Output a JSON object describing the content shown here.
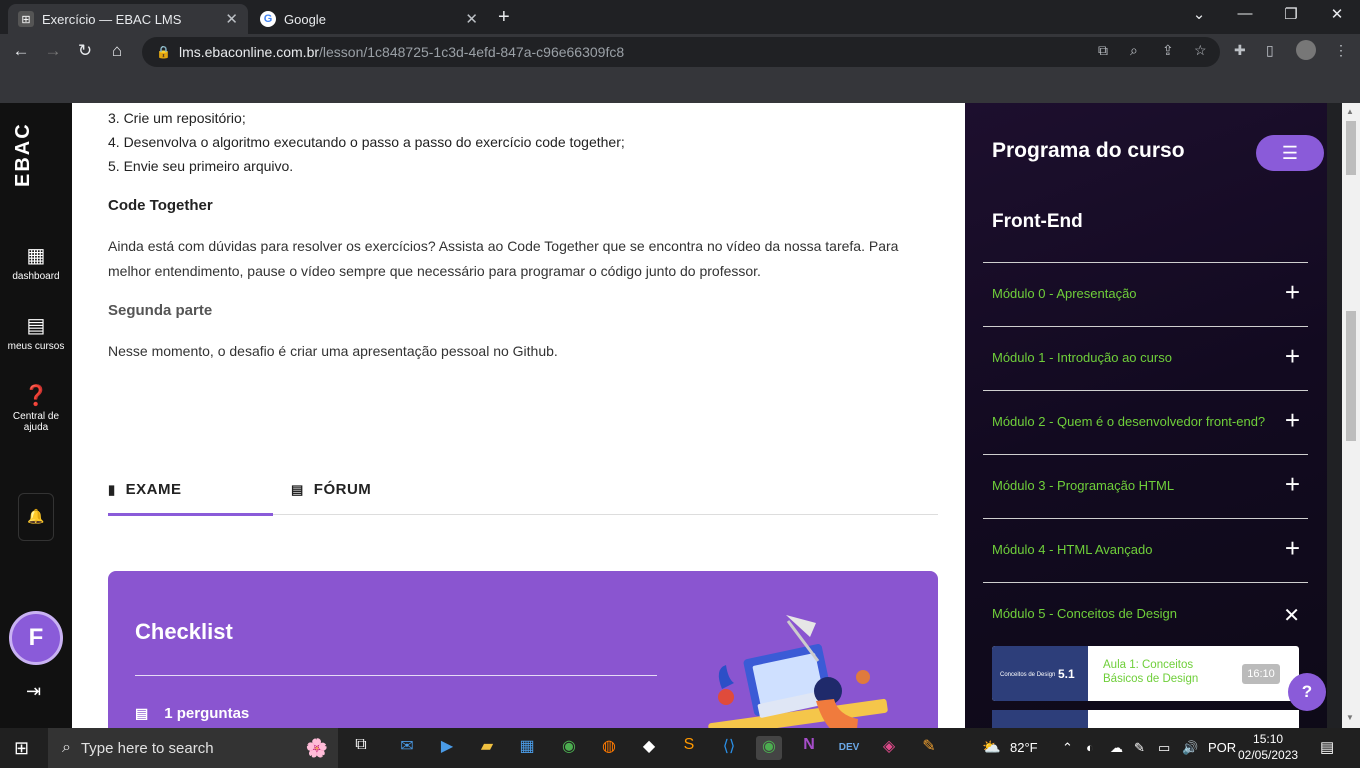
{
  "browser": {
    "tabs": [
      {
        "title": "Exercício — EBAC LMS",
        "active": true
      },
      {
        "title": "Google",
        "active": false
      }
    ],
    "url_host": "lms.ebaconline.com.br",
    "url_path": "/lesson/1c848725-1c3d-4efd-847a-c96e66309fc8"
  },
  "sidenav": {
    "logo": "EBAC",
    "items": [
      {
        "label": "dashboard",
        "icon": "dashboard-icon"
      },
      {
        "label": "meus cursos",
        "icon": "courses-icon"
      },
      {
        "label": "Central de ajuda",
        "icon": "help-icon"
      }
    ],
    "avatar_initial": "F"
  },
  "content": {
    "steps": [
      "3. Crie um repositório;",
      "4. Desenvolva o algoritmo executando o passo a passo do exercício code together;",
      "5. Envie seu primeiro arquivo."
    ],
    "code_together_title": "Code Together",
    "code_together_text": "Ainda está com dúvidas para resolver os exercícios? Assista ao Code Together que se encontra no vídeo da nossa tarefa. Para melhor entendimento, pause o vídeo sempre que necessário para programar o código junto do professor.",
    "segunda_parte_title": "Segunda parte",
    "segunda_parte_text": "Nesse momento, o desafio é criar uma apresentação pessoal no Github.",
    "tabs": [
      {
        "label": "EXAME",
        "icon": "chart-icon",
        "active": true
      },
      {
        "label": "FÓRUM",
        "icon": "comment-icon",
        "active": false
      }
    ],
    "checklist": {
      "title": "Checklist",
      "questions": "1 perguntas"
    }
  },
  "program": {
    "title": "Programa do curso",
    "section": "Front-End",
    "modules": [
      {
        "label": "Módulo 0 - Apresentação",
        "expanded": false
      },
      {
        "label": "Módulo 1 - Introdução ao curso",
        "expanded": false
      },
      {
        "label": "Módulo 2 - Quem é o desenvolvedor front-end?",
        "expanded": false
      },
      {
        "label": "Módulo 3 - Programação HTML",
        "expanded": false
      },
      {
        "label": "Módulo 4 - HTML Avançado",
        "expanded": false
      },
      {
        "label": "Módulo 5 - Conceitos de Design",
        "expanded": true
      }
    ],
    "lesson": {
      "thumb_label": "Conceitos de Design",
      "thumb_number": "5.1",
      "name": "Aula 1: Conceitos Básicos de Design",
      "duration": "16:10"
    }
  },
  "taskbar": {
    "search_placeholder": "Type here to search",
    "weather": "82°F",
    "language": "POR",
    "time": "15:10",
    "date": "02/05/2023"
  },
  "colors": {
    "accent": "#8a5bd9",
    "module_green": "#6fcf3a"
  }
}
